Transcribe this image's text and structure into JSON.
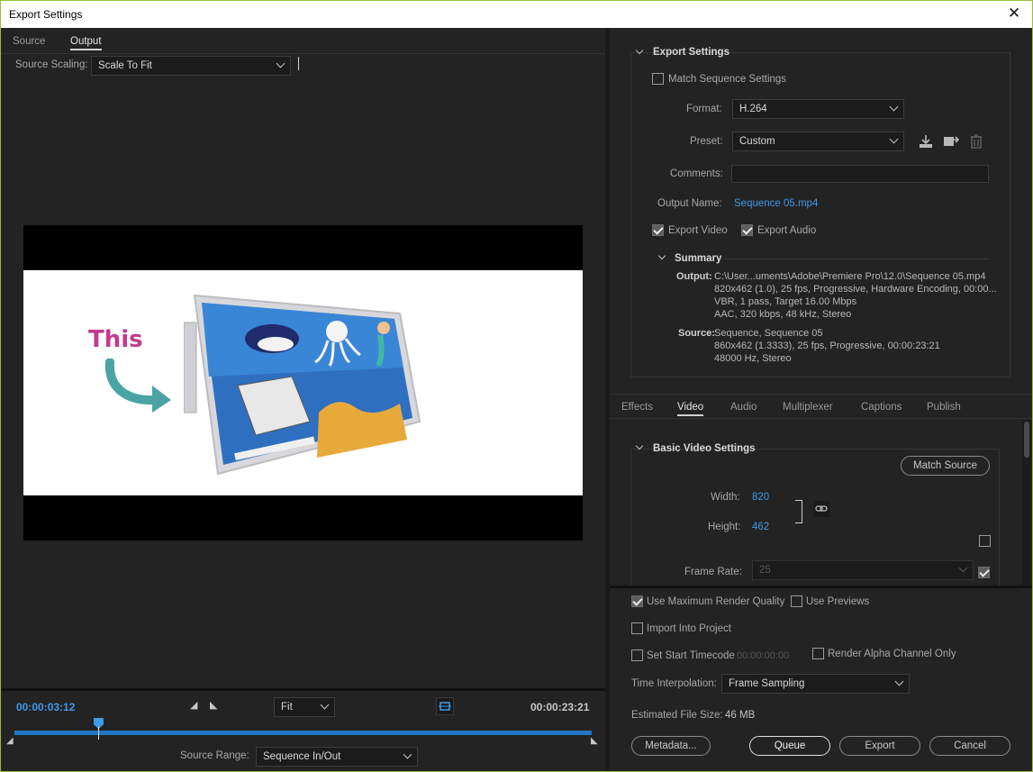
{
  "window": {
    "title": "Export Settings"
  },
  "left": {
    "tabs": [
      {
        "label": "Source"
      },
      {
        "label": "Output"
      }
    ],
    "source_scaling_label": "Source Scaling:",
    "source_scaling_value": "Scale To Fit",
    "preview_overlay_text": "This",
    "timecode_current": "00:00:03:12",
    "timecode_total": "00:00:23:21",
    "zoom_value": "Fit",
    "source_range_label": "Source Range:",
    "source_range_value": "Sequence In/Out",
    "playhead_progress": 0.145
  },
  "export_settings": {
    "header": "Export Settings",
    "match_sequence_label": "Match Sequence Settings",
    "match_sequence_checked": false,
    "format_label": "Format:",
    "format_value": "H.264",
    "preset_label": "Preset:",
    "preset_value": "Custom",
    "comments_label": "Comments:",
    "comments_value": "",
    "output_name_label": "Output Name:",
    "output_name_value": "Sequence 05.mp4",
    "export_video_label": "Export Video",
    "export_audio_label": "Export Audio",
    "summary": {
      "header": "Summary",
      "output_label": "Output:",
      "output_lines": [
        "C:\\User...uments\\Adobe\\Premiere Pro\\12.0\\Sequence 05.mp4",
        "820x462 (1.0), 25 fps, Progressive, Hardware Encoding, 00:00...",
        "VBR, 1 pass, Target 16.00 Mbps",
        "AAC, 320 kbps, 48 kHz, Stereo"
      ],
      "source_label": "Source:",
      "source_lines": [
        "Sequence, Sequence 05",
        "860x462 (1.3333), 25 fps, Progressive, 00:00:23:21",
        "48000 Hz, Stereo"
      ]
    }
  },
  "settings_tabs": [
    {
      "label": "Effects"
    },
    {
      "label": "Video"
    },
    {
      "label": "Audio"
    },
    {
      "label": "Multiplexer"
    },
    {
      "label": "Captions"
    },
    {
      "label": "Publish"
    }
  ],
  "video": {
    "header": "Basic Video Settings",
    "match_source_label": "Match Source",
    "width_label": "Width:",
    "width_value": "820",
    "height_label": "Height:",
    "height_value": "462",
    "frame_rate_label": "Frame Rate:",
    "frame_rate_value": "25"
  },
  "bottom": {
    "max_render_label": "Use Maximum Render Quality",
    "use_previews_label": "Use Previews",
    "import_label": "Import Into Project",
    "start_timecode_label": "Set Start Timecode",
    "start_timecode_value": "00:00:00:00",
    "alpha_label": "Render Alpha Channel Only",
    "time_interp_label": "Time Interpolation:",
    "time_interp_value": "Frame Sampling",
    "file_size_label": "Estimated File Size:",
    "file_size_value": "46 MB",
    "metadata_label": "Metadata...",
    "queue_label": "Queue",
    "export_label": "Export",
    "cancel_label": "Cancel"
  }
}
